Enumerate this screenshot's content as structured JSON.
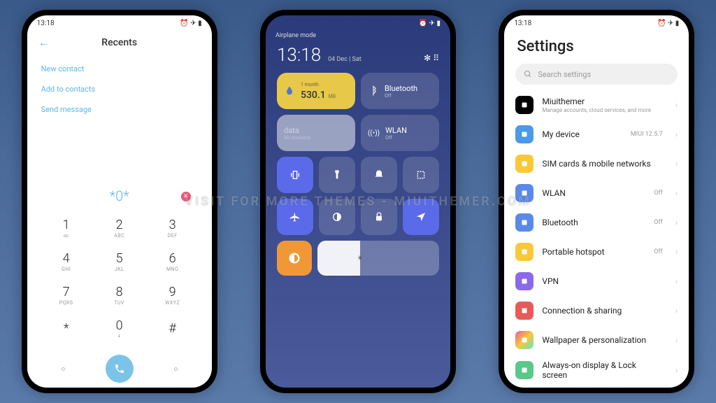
{
  "status": {
    "time": "13:18"
  },
  "dialer": {
    "title": "Recents",
    "links": [
      "New contact",
      "Add to contacts",
      "Send message"
    ],
    "entered": "*0*",
    "keys": [
      {
        "n": "1",
        "s": "∞"
      },
      {
        "n": "2",
        "s": "ABC"
      },
      {
        "n": "3",
        "s": "DEF"
      },
      {
        "n": "4",
        "s": "GHI"
      },
      {
        "n": "5",
        "s": "JKL"
      },
      {
        "n": "6",
        "s": "MNO"
      },
      {
        "n": "7",
        "s": "PQRS"
      },
      {
        "n": "8",
        "s": "TUV"
      },
      {
        "n": "9",
        "s": "WXYZ"
      },
      {
        "n": "*",
        "s": ""
      },
      {
        "n": "0",
        "s": "+"
      },
      {
        "n": "#",
        "s": ""
      }
    ]
  },
  "cc": {
    "airplane": "Airplane mode",
    "time": "13:18",
    "date": "04 Dec | Sat",
    "tiles": {
      "data": {
        "label": "1 month",
        "value": "530.1",
        "unit": "MB"
      },
      "bluetooth": {
        "name": "Bluetooth",
        "state": "Off"
      },
      "wlan": {
        "name": "WLAN",
        "state": "Off"
      },
      "mobile": {
        "name": "data",
        "state": "No available"
      }
    }
  },
  "settings": {
    "title": "Settings",
    "search_placeholder": "Search settings",
    "items": [
      {
        "label": "Miuithemer",
        "sub": "Manage accounts, cloud services, and more",
        "icon": "black",
        "right": ""
      },
      {
        "label": "My device",
        "icon": "blue",
        "right": "MIUI 12.5.7"
      },
      {
        "label": "SIM cards & mobile networks",
        "icon": "yellow",
        "right": ""
      },
      {
        "label": "WLAN",
        "icon": "blue2",
        "right": "Off"
      },
      {
        "label": "Bluetooth",
        "icon": "blue2",
        "right": "Off"
      },
      {
        "label": "Portable hotspot",
        "icon": "yellow",
        "right": "Off"
      },
      {
        "label": "VPN",
        "icon": "purple",
        "right": ""
      },
      {
        "label": "Connection & sharing",
        "icon": "red",
        "right": ""
      },
      {
        "label": "Wallpaper & personalization",
        "icon": "multi",
        "right": ""
      },
      {
        "label": "Always-on display & Lock screen",
        "icon": "green",
        "right": ""
      }
    ]
  },
  "watermark": "VISIT FOR MORE THEMES - MIUITHEMER.COM"
}
